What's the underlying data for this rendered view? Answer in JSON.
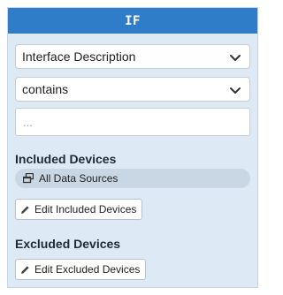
{
  "panel": {
    "title": "IF",
    "field_select": {
      "value": "Interface Description"
    },
    "operator_select": {
      "value": "contains"
    },
    "value_input": {
      "value": "",
      "placeholder": "..."
    },
    "included": {
      "heading": "Included Devices",
      "chip_label": "All Data Sources",
      "edit_button": "Edit Included Devices"
    },
    "excluded": {
      "heading": "Excluded Devices",
      "edit_button": "Edit Excluded Devices"
    }
  },
  "colors": {
    "header_bg": "#2f7cc9",
    "panel_bg": "#dde9f5",
    "chip_bg": "#c9d6e3"
  },
  "icons": {
    "select_caret": "chevron-down-icon",
    "chip": "stacked-windows-icon",
    "edit": "pencil-icon"
  }
}
